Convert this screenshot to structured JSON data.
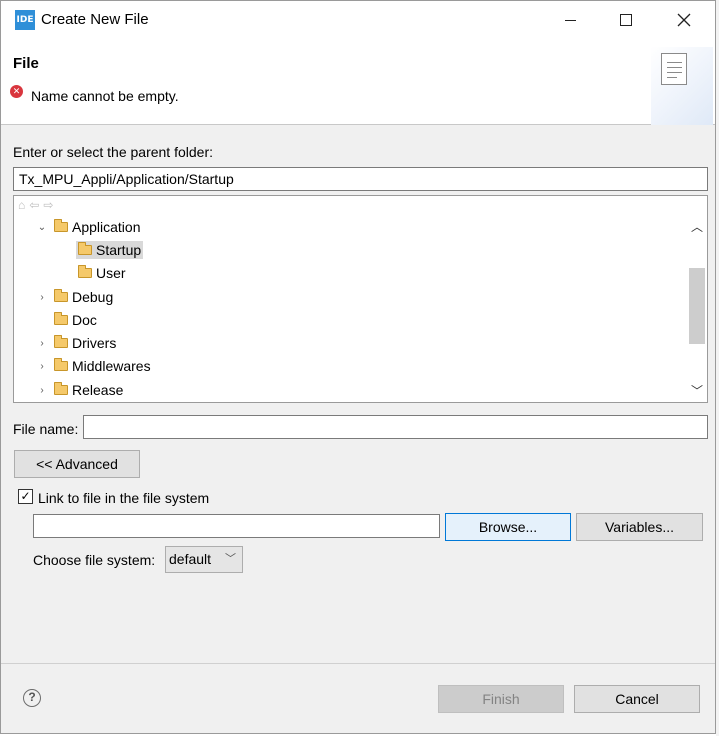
{
  "window": {
    "icon_text": "IDE",
    "title": "Create New File"
  },
  "banner": {
    "title": "File",
    "error_message": "Name cannot be empty."
  },
  "parent_folder": {
    "label": "Enter or select the parent folder:",
    "value": "Tx_MPU_Appli/Application/Startup"
  },
  "tree": {
    "items": [
      {
        "label": "Application",
        "state": "expanded",
        "level": 1
      },
      {
        "label": "Startup",
        "state": "leaf",
        "level": 2,
        "selected": true
      },
      {
        "label": "User",
        "state": "leaf",
        "level": 2
      },
      {
        "label": "Debug",
        "state": "collapsed",
        "level": 1
      },
      {
        "label": "Doc",
        "state": "leaf",
        "level": 1
      },
      {
        "label": "Drivers",
        "state": "collapsed",
        "level": 1
      },
      {
        "label": "Middlewares",
        "state": "collapsed",
        "level": 1
      },
      {
        "label": "Release",
        "state": "collapsed",
        "level": 1
      }
    ]
  },
  "file_name": {
    "label": "File name:",
    "value": ""
  },
  "advanced_button": "<< Advanced",
  "link": {
    "checkbox_label": "Link to file in the file system",
    "checked": true,
    "path_value": "",
    "browse_button": "Browse...",
    "variables_button": "Variables..."
  },
  "file_system": {
    "label": "Choose file system:",
    "selected": "default"
  },
  "footer": {
    "finish_button": "Finish",
    "cancel_button": "Cancel"
  }
}
